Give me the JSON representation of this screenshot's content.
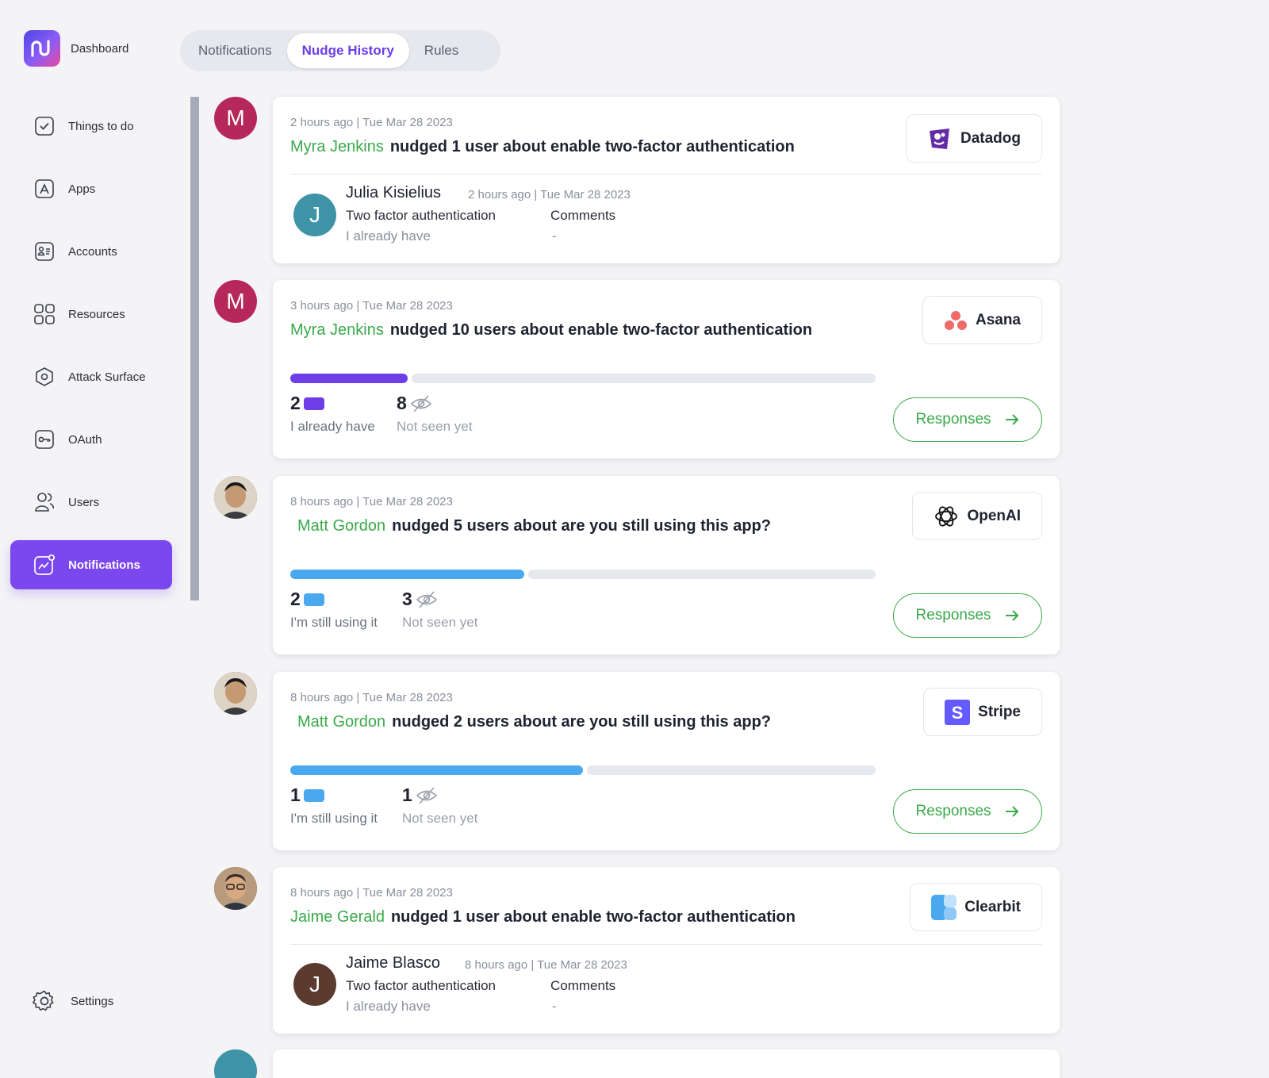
{
  "brand": {
    "label": "Dashboard"
  },
  "nav": [
    {
      "label": "Things to do",
      "icon": "checkbox-icon"
    },
    {
      "label": "Apps",
      "icon": "apps-icon"
    },
    {
      "label": "Accounts",
      "icon": "accounts-icon"
    },
    {
      "label": "Resources",
      "icon": "resources-icon"
    },
    {
      "label": "Attack Surface",
      "icon": "attack-surface-icon"
    },
    {
      "label": "OAuth",
      "icon": "key-icon"
    },
    {
      "label": "Users",
      "icon": "users-icon"
    },
    {
      "label": "Notifications",
      "icon": "notifications-icon",
      "active": true
    }
  ],
  "settings": {
    "label": "Settings"
  },
  "tabs": [
    {
      "label": "Notifications"
    },
    {
      "label": "Nudge History",
      "active": true
    },
    {
      "label": "Rules"
    }
  ],
  "colors": {
    "accent": "#7b47ee",
    "green": "#3aa94a",
    "purple_bar": "#6d3de8",
    "blue_bar": "#4aa8ef"
  },
  "feed": [
    {
      "avatar_letter": "M",
      "meta": "2 hours ago | Tue Mar 28 2023",
      "actor": "Myra Jenkins",
      "action": "nudged 1 user about enable two-factor authentication",
      "app": "Datadog",
      "response": {
        "avatar_letter": "J",
        "name": "Julia Kisielius",
        "meta": "2 hours ago | Tue Mar 28 2023",
        "question": "Two factor authentication",
        "answer": "I already have",
        "comments_label": "Comments",
        "comments_value": "-"
      }
    },
    {
      "avatar_letter": "M",
      "meta": "3 hours ago | Tue Mar 28 2023",
      "actor": "Myra Jenkins",
      "action": "nudged 10 users about enable two-factor authentication",
      "app": "Asana",
      "stat_a": {
        "count": "2",
        "label": "I already have"
      },
      "stat_b": {
        "count": "8",
        "label": "Not seen yet"
      },
      "progress": 0.2,
      "button": "Responses"
    },
    {
      "meta": "8 hours ago | Tue Mar 28 2023",
      "actor": "Matt Gordon",
      "action": "nudged 5 users about are you still using this app?",
      "app": "OpenAI",
      "stat_a": {
        "count": "2",
        "label": "I'm still using it"
      },
      "stat_b": {
        "count": "3",
        "label": "Not seen yet"
      },
      "progress": 0.4,
      "button": "Responses"
    },
    {
      "meta": "8 hours ago | Tue Mar 28 2023",
      "actor": "Matt Gordon",
      "action": "nudged 2 users about are you still using this app?",
      "app": "Stripe",
      "stat_a": {
        "count": "1",
        "label": "I'm still using it"
      },
      "stat_b": {
        "count": "1",
        "label": "Not seen yet"
      },
      "progress": 0.5,
      "button": "Responses"
    },
    {
      "meta": "8 hours ago | Tue Mar 28 2023",
      "actor": "Jaime Gerald",
      "action": "nudged 1 user about enable two-factor authentication",
      "app": "Clearbit",
      "response": {
        "avatar_letter": "J",
        "name": "Jaime Blasco",
        "meta": "8 hours ago | Tue Mar 28 2023",
        "question": "Two factor authentication",
        "answer": "I already have",
        "comments_label": "Comments",
        "comments_value": "-"
      }
    }
  ]
}
